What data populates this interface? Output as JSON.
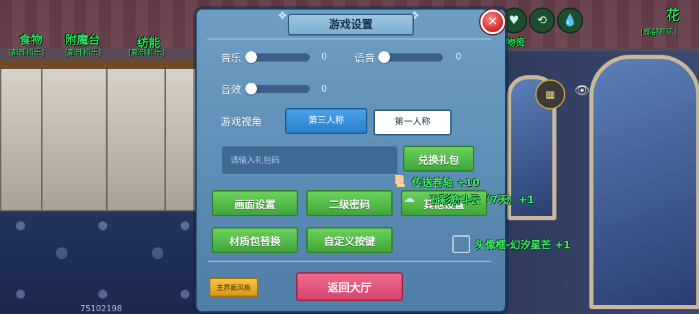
{
  "background": {
    "npc_names": [
      "食物",
      "附魔台",
      "纺能",
      "花"
    ],
    "npc_tags": [
      "[都部抓乐]",
      "[都部抓乐]",
      "[都部抓乐]",
      "[都部抓乐]"
    ],
    "right_label": "物资",
    "player_id": "75102198"
  },
  "hud": {
    "icons": [
      "heart-icon",
      "refresh-icon",
      "drop-icon"
    ]
  },
  "panel": {
    "title": "游戏设置",
    "close_label": "✕",
    "music_label": "音乐",
    "music_value": "0",
    "voice_label": "语音",
    "voice_value": "0",
    "sfx_label": "音效",
    "sfx_value": "0",
    "view_label": "游戏视角",
    "view_third": "第三人称",
    "view_first": "第一人称",
    "gift_placeholder": "请输入礼包码",
    "redeem_label": "兑换礼包",
    "graphics_label": "画面设置",
    "password_label": "二级密码",
    "other_label": "其他设置",
    "texture_label": "材质包替换",
    "custom_keys_label": "自定义按键",
    "ui_style_label": "主界面风格",
    "return_label": "返回大厅"
  },
  "rewards": [
    {
      "text": "传送卷轴 +10",
      "icon": "scroll-icon"
    },
    {
      "text": "五彩筋斗云（7天）+1",
      "icon": "cloud-icon"
    },
    {
      "text": "头像框-幻汐星芒 +1",
      "icon": "frame-icon"
    }
  ]
}
